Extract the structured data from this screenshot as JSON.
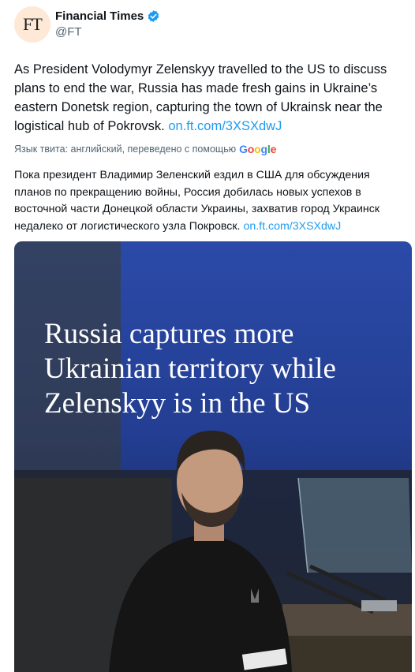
{
  "account": {
    "avatar_text": "FT",
    "name": "Financial Times",
    "handle": "@FT",
    "verified": true,
    "verified_color": "#1d9bf0"
  },
  "tweet": {
    "text": "As President Volodymyr Zelenskyy travelled to the US to discuss plans to end the war, Russia has made fresh gains in Ukraine’s eastern Donetsk region, capturing the town of Ukrainsk near the logistical hub of Pokrovsk. ",
    "link": "on.ft.com/3XSXdwJ",
    "link_color": "#1d9bf0"
  },
  "translation": {
    "note": "Язык твита: английский, переведено с помощью",
    "provider": "Google",
    "text": "Пока президент Владимир Зеленский ездил в США для обсуждения планов по прекращению войны, Россия добилась новых успехов в восточной части Донецкой области Украины, захватив город Украинск недалеко от логистического узла Покровск. ",
    "link": "on.ft.com/3XSXdwJ"
  },
  "media": {
    "headline_lines": [
      "Russia captures more",
      "Ukrainian territory while",
      "Zelenskyy is in the US"
    ]
  }
}
